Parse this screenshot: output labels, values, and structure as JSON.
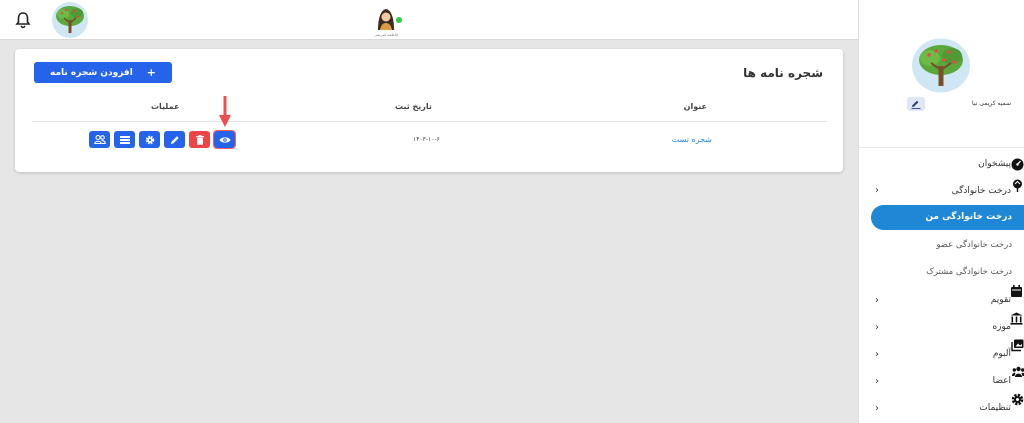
{
  "topbar": {
    "bell_icon": "bell-icon",
    "logo_icon": "family-tree-logo",
    "user_name": "فاطمه شریفی",
    "status_color": "#2ecc40"
  },
  "page": {
    "title": "شجره نامه ها",
    "add_button": "افزودن شجره نامه",
    "add_icon": "+",
    "columns": {
      "title": "عنوان",
      "date": "تاریخ ثبت",
      "ops": "عملیات"
    },
    "rows": [
      {
        "name": "شجره تست",
        "date": "۱۴۰۳-۱۰-۶"
      }
    ],
    "row_actions": [
      "members-icon",
      "list-icon",
      "settings-icon",
      "edit-icon",
      "delete-icon",
      "view-icon"
    ],
    "accent": "#2563eb",
    "danger": "#ef4444",
    "annotation_color": "#f04e4e"
  },
  "sidebar": {
    "profile_name": "سمیه کریمی نیا",
    "active_color": "#1e88d6",
    "items": [
      {
        "label": "پیشخوان",
        "icon": "dashboard-icon"
      },
      {
        "label": "درخت خانوادگی",
        "icon": "tree-icon"
      },
      {
        "label": "درخت خانوادگی من"
      },
      {
        "label": "درخت خانوادگی عضو"
      },
      {
        "label": "درخت خانوادگی مشترک"
      },
      {
        "label": "تقویم",
        "icon": "calendar-icon"
      },
      {
        "label": "موزه",
        "icon": "museum-icon"
      },
      {
        "label": "آلبوم",
        "icon": "album-icon"
      },
      {
        "label": "اعضا",
        "icon": "people-icon"
      },
      {
        "label": "تنظیمات",
        "icon": "gear-icon"
      }
    ],
    "chevron": "‹"
  }
}
